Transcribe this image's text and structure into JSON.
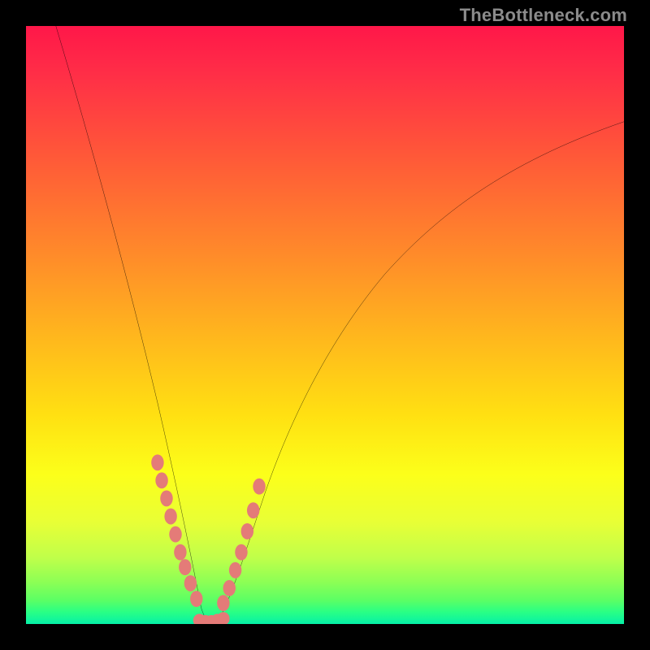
{
  "watermark_text": "TheBottleneck.com",
  "chart_data": {
    "type": "line",
    "title": "",
    "xlabel": "",
    "ylabel": "",
    "xlim": [
      0,
      100
    ],
    "ylim": [
      0,
      100
    ],
    "series": [
      {
        "name": "left-branch",
        "x": [
          5,
          7,
          9,
          11,
          13,
          15,
          17,
          19,
          21,
          23,
          25,
          27,
          29,
          30,
          31
        ],
        "values": [
          100,
          92,
          84,
          76,
          68,
          60,
          52,
          43,
          34,
          25,
          16,
          10,
          4,
          1,
          0
        ]
      },
      {
        "name": "right-branch",
        "x": [
          31,
          33,
          35,
          37,
          40,
          44,
          49,
          55,
          62,
          70,
          79,
          89,
          100
        ],
        "values": [
          0,
          3,
          8,
          14,
          22,
          31,
          40,
          49,
          58,
          66,
          73,
          79,
          84
        ]
      }
    ],
    "markers": {
      "comment": "salmon dot markers overlaid on the two branches near the trough",
      "left_dots": [
        [
          22,
          27
        ],
        [
          22.7,
          24
        ],
        [
          23.5,
          21
        ],
        [
          24.2,
          18
        ],
        [
          25,
          15
        ],
        [
          25.8,
          12
        ],
        [
          26.6,
          9.5
        ],
        [
          27.5,
          6.8
        ],
        [
          28.5,
          4.2
        ]
      ],
      "right_dots": [
        [
          33,
          3.5
        ],
        [
          34,
          6
        ],
        [
          35,
          9
        ],
        [
          36,
          12
        ],
        [
          37,
          15.5
        ],
        [
          38,
          19
        ],
        [
          39,
          23
        ]
      ],
      "flat_bottom": [
        [
          29,
          0.6
        ],
        [
          30,
          0.4
        ],
        [
          31,
          0.4
        ],
        [
          32,
          0.6
        ],
        [
          33,
          0.9
        ]
      ]
    },
    "colors": {
      "curve": "#000000",
      "markers": "#e47b78",
      "gradient_top": "#ff1749",
      "gradient_bottom": "#05f0a7"
    }
  }
}
